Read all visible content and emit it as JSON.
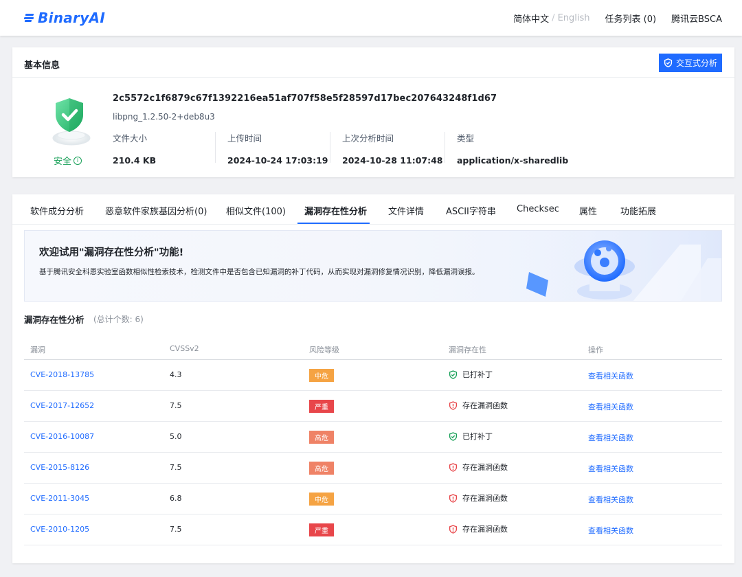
{
  "header": {
    "logo_text": "BinaryAI",
    "lang_active": "简体中文",
    "lang_separator": "/",
    "lang_inactive": "English",
    "tasks": "任务列表 (0)",
    "account": "腾讯云BSCA"
  },
  "basic_info": {
    "title": "基本信息",
    "interact_button": "交互式分析",
    "status": "安全",
    "status_info_icon": "i",
    "hash": "2c5572c1f6879c67f1392216ea51af707f58e5f28597d17bec207643248f1d67",
    "package": "libpng_1.2.50-2+deb8u3",
    "meta": [
      {
        "key": "文件大小",
        "value": "210.4 KB"
      },
      {
        "key": "上传时间",
        "value": "2024-10-24 17:03:19"
      },
      {
        "key": "上次分析时间",
        "value": "2024-10-28 11:07:48"
      },
      {
        "key": "类型",
        "value": "application/x-sharedlib"
      }
    ]
  },
  "tabs": [
    {
      "label": "软件成分分析"
    },
    {
      "label": "恶意软件家族基因分析(0)"
    },
    {
      "label": "相似文件(100)"
    },
    {
      "label": "漏洞存在性分析",
      "active": true
    },
    {
      "label": "文件详情"
    },
    {
      "label": "ASCII字符串"
    },
    {
      "label": "Checksec"
    },
    {
      "label": "属性"
    },
    {
      "label": "功能拓展"
    }
  ],
  "banner": {
    "title": "欢迎试用\"漏洞存在性分析\"功能!",
    "description": "基于腾讯安全科恩实验室函数相似性检索技术，检测文件中是否包含已知漏洞的补丁代码，从而实现对漏洞修复情况识别，降低漏洞误报。"
  },
  "section": {
    "title": "漏洞存在性分析",
    "count": "(总计个数: 6)"
  },
  "table": {
    "columns": [
      "漏洞",
      "CVSSv2",
      "风险等级",
      "漏洞存在性",
      "操作"
    ],
    "rows": [
      {
        "cve": "CVE-2018-13785",
        "cvss": "4.3",
        "risk": "中危",
        "exist": "已打补丁",
        "action": "查看相关函数"
      },
      {
        "cve": "CVE-2017-12652",
        "cvss": "7.5",
        "risk": "严重",
        "exist": "存在漏洞函数",
        "action": "查看相关函数"
      },
      {
        "cve": "CVE-2016-10087",
        "cvss": "5.0",
        "risk": "高危",
        "exist": "已打补丁",
        "action": "查看相关函数"
      },
      {
        "cve": "CVE-2015-8126",
        "cvss": "7.5",
        "risk": "高危",
        "exist": "存在漏洞函数",
        "action": "查看相关函数"
      },
      {
        "cve": "CVE-2011-3045",
        "cvss": "6.8",
        "risk": "中危",
        "exist": "存在漏洞函数",
        "action": "查看相关函数"
      },
      {
        "cve": "CVE-2010-1205",
        "cvss": "7.5",
        "risk": "严重",
        "exist": "存在漏洞函数",
        "action": "查看相关函数"
      }
    ]
  },
  "colors": {
    "primary": "#1f6bff",
    "safe": "#18a058",
    "risk_medium": "#f5a343",
    "risk_high": "#ef8266",
    "risk_critical": "#e8464a",
    "patched": "#18a058",
    "vulnerable": "#e8464a"
  }
}
